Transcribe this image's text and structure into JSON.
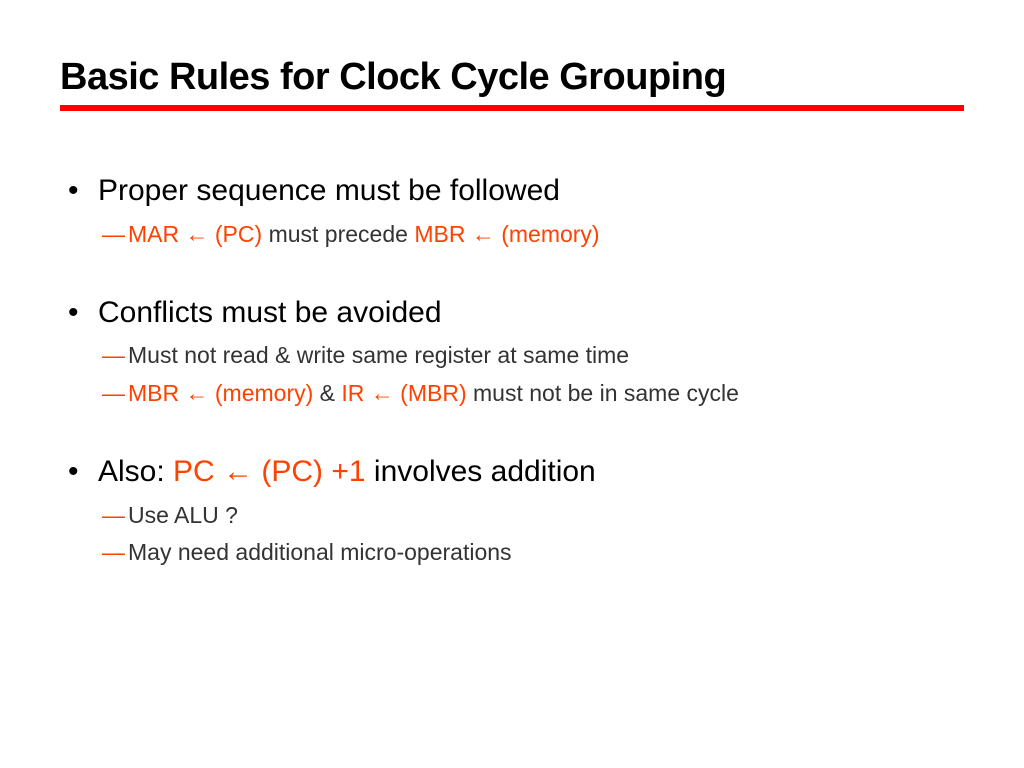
{
  "title": "Basic Rules for Clock Cycle Grouping",
  "groups": [
    {
      "bullet": {
        "text": "Proper sequence must be followed"
      },
      "subs": [
        {
          "parts": [
            {
              "t": "MAR ",
              "hl": true
            },
            {
              "t": "←",
              "hl": true,
              "arrow": true
            },
            {
              "t": " (PC) ",
              "hl": true
            },
            {
              "t": "must precede ",
              "hl": false
            },
            {
              "t": "MBR ",
              "hl": true
            },
            {
              "t": "←",
              "hl": true,
              "arrow": true
            },
            {
              "t": " (memory)",
              "hl": true
            }
          ]
        }
      ]
    },
    {
      "bullet": {
        "text": "Conflicts must be avoided"
      },
      "subs": [
        {
          "parts": [
            {
              "t": "Must not read & write same register at same time",
              "hl": false
            }
          ]
        },
        {
          "parts": [
            {
              "t": "MBR ",
              "hl": true
            },
            {
              "t": "←",
              "hl": true,
              "arrow": true
            },
            {
              "t": " (memory) ",
              "hl": true
            },
            {
              "t": "& ",
              "hl": false
            },
            {
              "t": "IR ",
              "hl": true
            },
            {
              "t": "←",
              "hl": true,
              "arrow": true
            },
            {
              "t": " (MBR) ",
              "hl": true
            },
            {
              "t": "must not be in same cycle",
              "hl": false
            }
          ]
        }
      ]
    },
    {
      "bullet": {
        "parts": [
          {
            "t": "Also:  ",
            "hl": false
          },
          {
            "t": "PC ",
            "hl": true
          },
          {
            "t": "←",
            "hl": true,
            "arrow": true
          },
          {
            "t": " (PC) +1 ",
            "hl": true
          },
          {
            "t": "involves addition",
            "hl": false
          }
        ]
      },
      "subs": [
        {
          "parts": [
            {
              "t": "Use ALU ?",
              "hl": false
            }
          ]
        },
        {
          "parts": [
            {
              "t": "May need additional micro-operations",
              "hl": false
            }
          ]
        }
      ]
    }
  ]
}
